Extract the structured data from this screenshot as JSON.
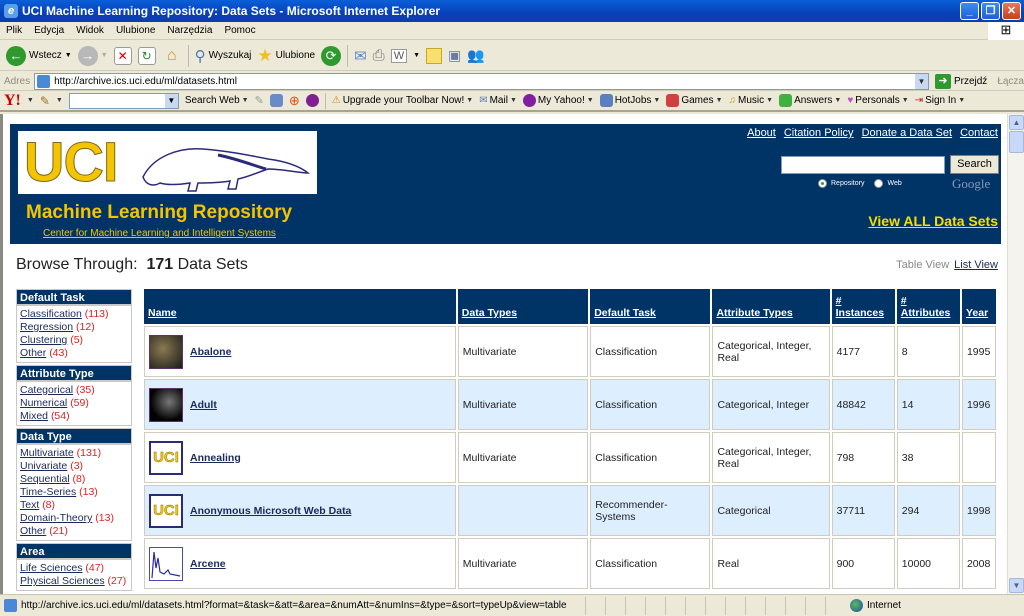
{
  "window": {
    "title": "UCI Machine Learning Repository: Data Sets - Microsoft Internet Explorer",
    "buttons": [
      "minimize",
      "restore",
      "close"
    ]
  },
  "menubar": [
    "Plik",
    "Edycja",
    "Widok",
    "Ulubione",
    "Narzędzia",
    "Pomoc"
  ],
  "toolbar": {
    "back": "Wstecz",
    "search": "Wyszukaj",
    "favorites": "Ulubione"
  },
  "address": {
    "label": "Adres",
    "url": "http://archive.ics.uci.edu/ml/datasets.html",
    "go": "Przejdź",
    "links": "Łącza"
  },
  "yahoo_toolbar": {
    "search_web": "Search Web",
    "items": [
      "Upgrade your Toolbar Now!",
      "Mail",
      "My Yahoo!",
      "HotJobs",
      "Games",
      "Music",
      "Answers",
      "Personals",
      "Sign In"
    ]
  },
  "banner": {
    "logo_text": "UCI",
    "title": "Machine Learning Repository",
    "subtitle_link": "Center for Machine Learning and Intelligent Systems",
    "top_links": [
      "About",
      "Citation Policy",
      "Donate a Data Set",
      "Contact"
    ],
    "search_button": "Search",
    "search_value": "",
    "radio_repository": "Repository",
    "radio_web": "Web",
    "google": "Google",
    "view_all": "View ALL Data Sets"
  },
  "browse": {
    "label": "Browse Through:",
    "count": "171",
    "count_suffix": "Data Sets",
    "table_view": "Table View",
    "list_view": "List View"
  },
  "sidebar": [
    {
      "heading": "Default Task",
      "items": [
        {
          "label": "Classification",
          "count": "(113)"
        },
        {
          "label": "Regression",
          "count": "(12)"
        },
        {
          "label": "Clustering",
          "count": "(5)"
        },
        {
          "label": "Other",
          "count": "(43)"
        }
      ]
    },
    {
      "heading": "Attribute Type",
      "items": [
        {
          "label": "Categorical",
          "count": "(35)"
        },
        {
          "label": "Numerical",
          "count": "(59)"
        },
        {
          "label": "Mixed",
          "count": "(54)"
        }
      ]
    },
    {
      "heading": "Data Type",
      "items": [
        {
          "label": "Multivariate",
          "count": "(131)"
        },
        {
          "label": "Univariate",
          "count": "(3)"
        },
        {
          "label": "Sequential",
          "count": "(8)"
        },
        {
          "label": "Time-Series",
          "count": "(13)"
        },
        {
          "label": "Text",
          "count": "(8)"
        },
        {
          "label": "Domain-Theory",
          "count": "(13)"
        },
        {
          "label": "Other",
          "count": "(21)"
        }
      ]
    },
    {
      "heading": "Area",
      "items": [
        {
          "label": "Life Sciences",
          "count": "(47)"
        },
        {
          "label": "Physical Sciences",
          "count": "(27)"
        }
      ]
    }
  ],
  "table": {
    "headers": [
      "Name",
      "Data Types",
      "Default Task",
      "Attribute Types",
      "# Instances",
      "# Attributes",
      "Year"
    ],
    "rows": [
      {
        "name": "Abalone",
        "thumb": "abalone",
        "data_types": "Multivariate",
        "task": "Classification",
        "attr_types": "Categorical, Integer, Real",
        "instances": "4177",
        "attributes": "8",
        "year": "1995"
      },
      {
        "name": "Adult",
        "thumb": "adult",
        "data_types": "Multivariate",
        "task": "Classification",
        "attr_types": "Categorical, Integer",
        "instances": "48842",
        "attributes": "14",
        "year": "1996"
      },
      {
        "name": "Annealing",
        "thumb": "uci",
        "data_types": "Multivariate",
        "task": "Classification",
        "attr_types": "Categorical, Integer, Real",
        "instances": "798",
        "attributes": "38",
        "year": ""
      },
      {
        "name": "Anonymous Microsoft Web Data",
        "thumb": "uci",
        "data_types": "",
        "task": "Recommender-Systems",
        "attr_types": "Categorical",
        "instances": "37711",
        "attributes": "294",
        "year": "1998"
      },
      {
        "name": "Arcene",
        "thumb": "chart",
        "data_types": "Multivariate",
        "task": "Classification",
        "attr_types": "Real",
        "instances": "900",
        "attributes": "10000",
        "year": "2008"
      }
    ]
  },
  "status": {
    "url": "http://archive.ics.uci.edu/ml/datasets.html?format=&task=&att=&area=&numAtt=&numIns=&type=&sort=typeUp&view=table",
    "zone": "Internet"
  }
}
